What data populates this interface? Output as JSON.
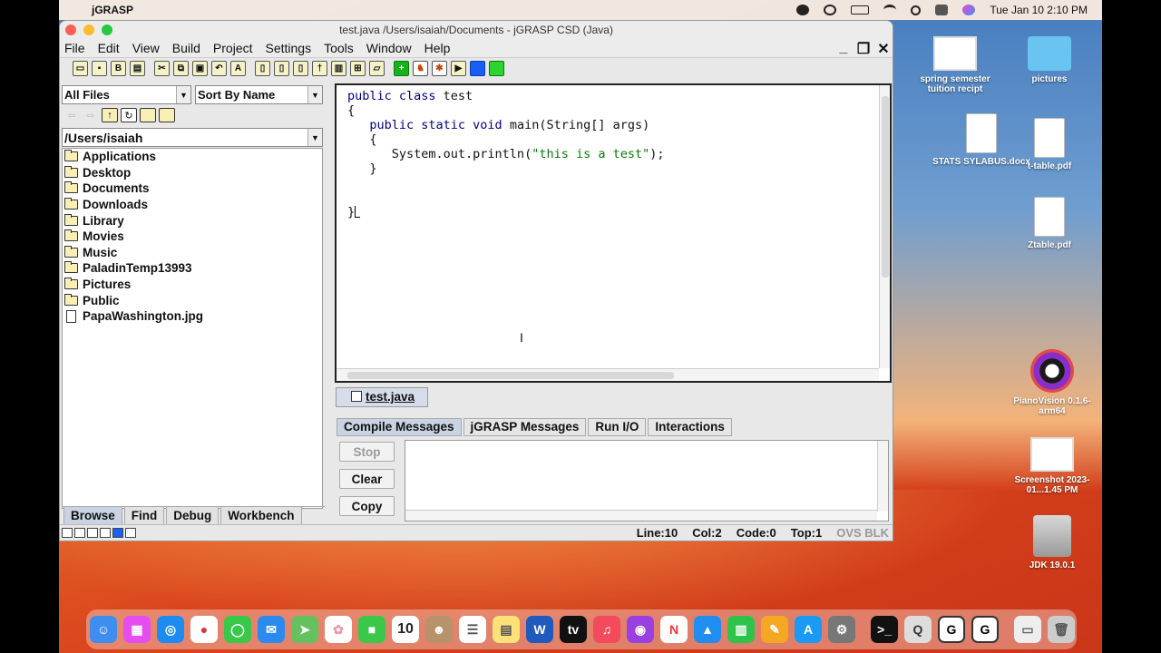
{
  "menubar": {
    "app_name": "jGRASP",
    "clock": "Tue Jan 10  2:10 PM"
  },
  "window": {
    "title": "test.java  /Users/isaiah/Documents - jGRASP CSD (Java)",
    "menus": [
      "File",
      "Edit",
      "View",
      "Build",
      "Project",
      "Settings",
      "Tools",
      "Window",
      "Help"
    ]
  },
  "browser": {
    "filter": "All Files",
    "sort": "Sort By Name",
    "path": "/Users/isaiah",
    "items": [
      {
        "name": "Applications",
        "type": "folder"
      },
      {
        "name": "Desktop",
        "type": "folder"
      },
      {
        "name": "Documents",
        "type": "folder"
      },
      {
        "name": "Downloads",
        "type": "folder"
      },
      {
        "name": "Library",
        "type": "folder"
      },
      {
        "name": "Movies",
        "type": "folder"
      },
      {
        "name": "Music",
        "type": "folder"
      },
      {
        "name": "PaladinTemp13993",
        "type": "folder"
      },
      {
        "name": "Pictures",
        "type": "folder"
      },
      {
        "name": "Public",
        "type": "folder"
      },
      {
        "name": "PapaWashington.jpg",
        "type": "file"
      }
    ],
    "tabs": [
      "Browse",
      "Find",
      "Debug",
      "Workbench"
    ]
  },
  "editor": {
    "file_tab": "test.java",
    "code": {
      "l1a": "public class",
      "l1b": " test",
      "l2": "{",
      "l3a": "   public static void",
      "l3b": " main(String[] args)",
      "l4": "   {",
      "l5a": "      System.out.println(",
      "l5b": "\"this is a test\"",
      "l5c": ");",
      "l6": "   }",
      "l9": "}"
    }
  },
  "messages": {
    "tabs": [
      "Compile Messages",
      "jGRASP Messages",
      "Run I/O",
      "Interactions"
    ],
    "stop": "Stop",
    "clear": "Clear",
    "copy": "Copy"
  },
  "status": {
    "line": "Line:10",
    "col": "Col:2",
    "code": "Code:0",
    "top": "Top:1",
    "mode": "OVS BLK"
  },
  "desktop": {
    "icons": [
      {
        "label": "spring semester tuition recipt"
      },
      {
        "label": "pictures"
      },
      {
        "label": "STATS SYLABUS.docx"
      },
      {
        "label": "t-table.pdf"
      },
      {
        "label": "Ztable.pdf"
      },
      {
        "label": "PianoVision 0.1.6-arm64"
      },
      {
        "label": "Screenshot 2023-01...1.45 PM"
      },
      {
        "label": "JDK 19.0.1"
      }
    ],
    "calendar_day": "10"
  },
  "colors": {
    "keyword": "#00007f",
    "string": "#087a08",
    "active_tab": "#c9d3e3"
  }
}
